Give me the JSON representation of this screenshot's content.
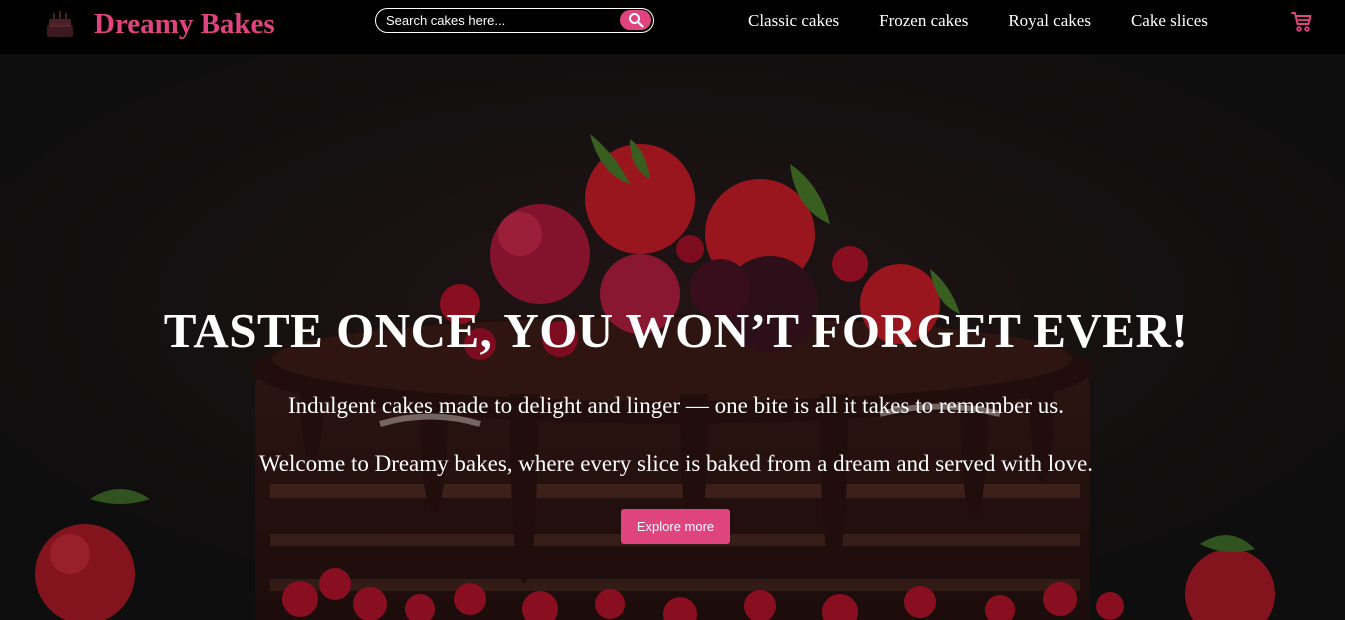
{
  "brand": {
    "name": "Dreamy Bakes",
    "icon": "cake-icon"
  },
  "search": {
    "placeholder": "Search cakes here...",
    "icon": "search-icon"
  },
  "nav": {
    "links": [
      {
        "label": "Classic cakes"
      },
      {
        "label": "Frozen cakes"
      },
      {
        "label": "Royal cakes"
      },
      {
        "label": "Cake slices"
      }
    ],
    "cart_icon": "cart-icon"
  },
  "hero": {
    "title": "TASTE ONCE, YOU WON’T FORGET EVER!",
    "subtitle1": "Indulgent cakes made to delight and linger — one bite is all it takes to remember us.",
    "subtitle2": "Welcome to Dreamy bakes, where every slice is baked from a dream and served with love.",
    "cta_label": "Explore more",
    "background": "chocolate-cake-with-berries-image"
  },
  "colors": {
    "accent": "#e0447f",
    "navbar": "#000000",
    "text": "#ffffff"
  }
}
